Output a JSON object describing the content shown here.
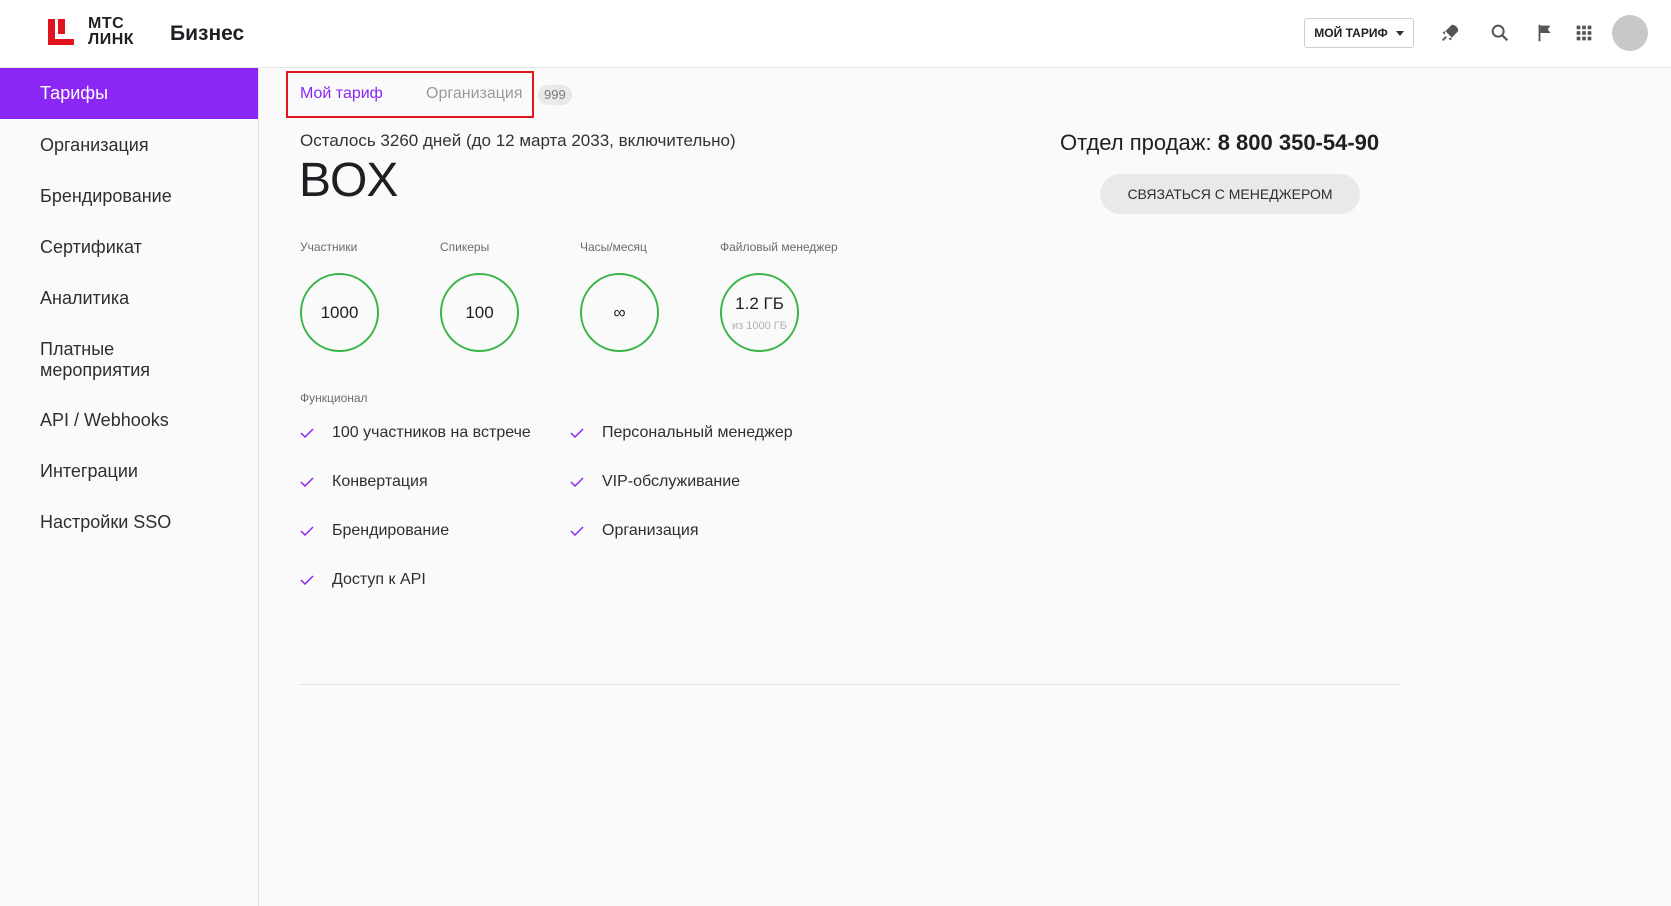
{
  "header": {
    "logo_text_line1": "МТС",
    "logo_text_line2": "ЛИНК",
    "product": "Бизнес",
    "tariff_button": "МОЙ ТАРИФ",
    "icons": [
      "rocket-icon",
      "search-icon",
      "flag-icon",
      "apps-grid-icon",
      "avatar"
    ]
  },
  "sidebar": {
    "items": [
      {
        "label": "Тарифы",
        "active": true
      },
      {
        "label": "Организация"
      },
      {
        "label": "Брендирование"
      },
      {
        "label": "Сертификат"
      },
      {
        "label": "Аналитика"
      },
      {
        "label": "Платные мероприятия"
      },
      {
        "label": "API / Webhooks"
      },
      {
        "label": "Интеграции"
      },
      {
        "label": "Настройки SSO"
      }
    ]
  },
  "tabs": {
    "items": [
      {
        "label": "Мой тариф",
        "active": true
      },
      {
        "label": "Организация"
      }
    ],
    "badge": "999"
  },
  "plan": {
    "remaining": "Осталось 3260 дней (до 12 марта 2033, включительно)",
    "name": "BOX"
  },
  "stats": [
    {
      "label": "Участники",
      "value": "1000"
    },
    {
      "label": "Спикеры",
      "value": "100"
    },
    {
      "label": "Часы/месяц",
      "value": "∞"
    },
    {
      "label": "Файловый менеджер",
      "value": "1.2 ГБ",
      "sub": "из 1000 ГБ"
    }
  ],
  "features": {
    "label": "Функционал",
    "left": [
      "100 участников на встрече",
      "Конвертация",
      "Брендирование",
      "Доступ к API"
    ],
    "right": [
      "Персональный менеджер",
      "VIP-обслуживание",
      "Организация"
    ]
  },
  "sales": {
    "label": "Отдел продаж:",
    "phone": "8 800 350-54-90",
    "button": "СВЯЗАТЬСЯ С МЕНЕДЖЕРОМ"
  },
  "colors": {
    "accent": "#8b27f5",
    "success": "#3bb54a",
    "brand_red": "#e0141e"
  }
}
